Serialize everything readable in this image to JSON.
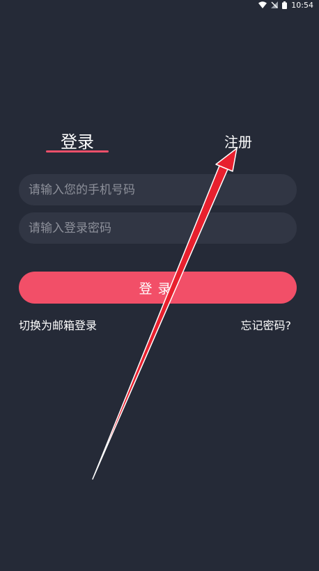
{
  "status_bar": {
    "time": "10:54",
    "icons": [
      "wifi-icon",
      "no-signal-icon",
      "battery-icon"
    ]
  },
  "tabs": {
    "login_label": "登录",
    "register_label": "注册"
  },
  "form": {
    "phone_placeholder": "请输入您的手机号码",
    "password_placeholder": "请输入登录密码",
    "login_button_label": "登录"
  },
  "links": {
    "switch_to_email": "切换为邮箱登录",
    "forgot_password": "忘记密码?"
  },
  "colors": {
    "background": "#252a37",
    "accent": "#f24f68",
    "input_bg": "#313644",
    "annotation_arrow": "#e8202e"
  }
}
